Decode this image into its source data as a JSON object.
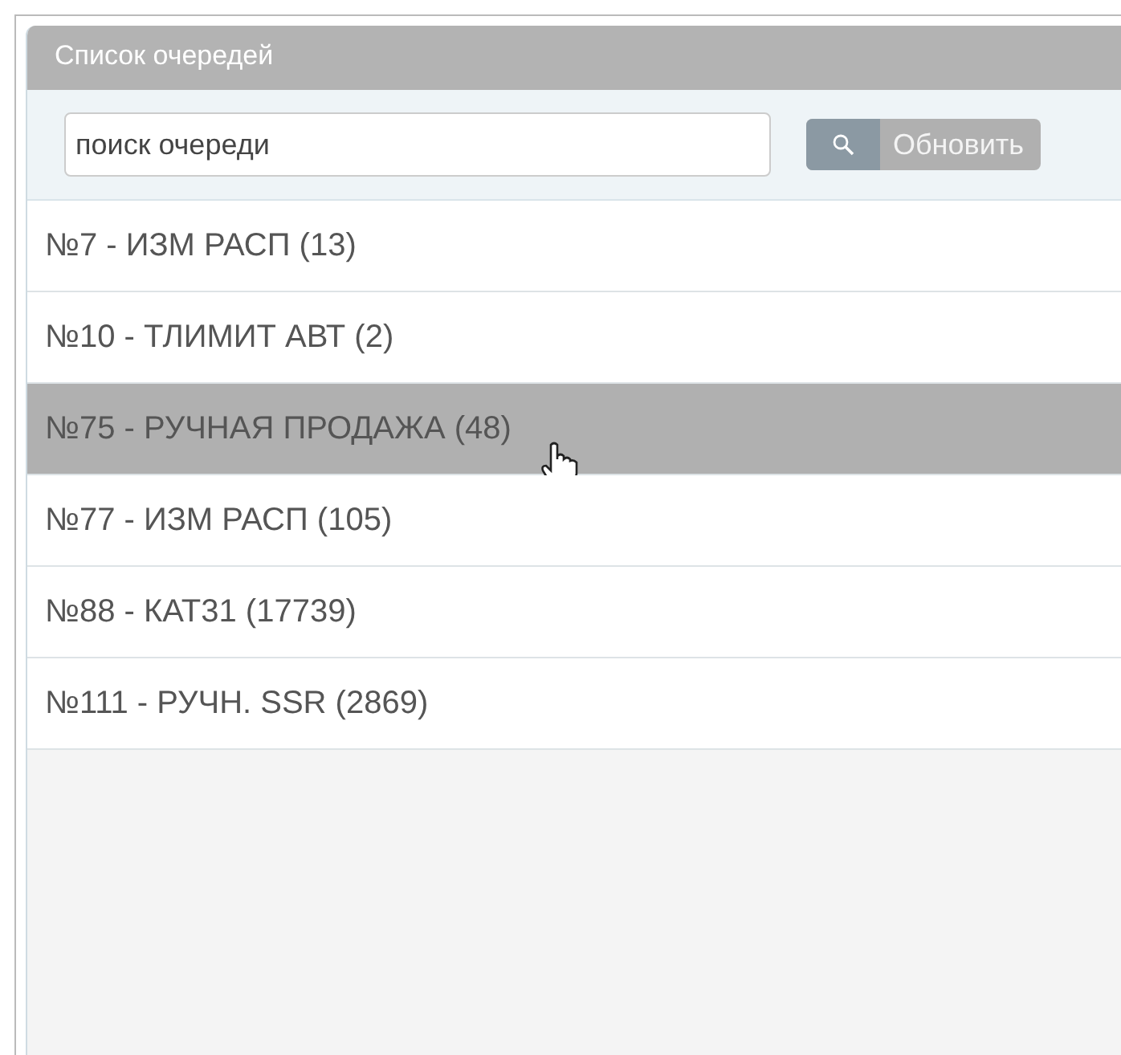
{
  "panel": {
    "title": "Список очередей"
  },
  "search": {
    "value": "поиск очереди"
  },
  "refresh_button": {
    "label": "Обновить"
  },
  "queues": [
    {
      "label": "№7 - ИЗМ РАСП (13)",
      "selected": false
    },
    {
      "label": "№10 - ТЛИМИТ АВТ (2)",
      "selected": false
    },
    {
      "label": "№75 - РУЧНАЯ ПРОДАЖА (48)",
      "selected": true
    },
    {
      "label": "№77 - ИЗМ РАСП (105)",
      "selected": false
    },
    {
      "label": "№88 - КАТ31 (17739)",
      "selected": false
    },
    {
      "label": "№111 - РУЧН. SSR (2869)",
      "selected": false
    }
  ]
}
